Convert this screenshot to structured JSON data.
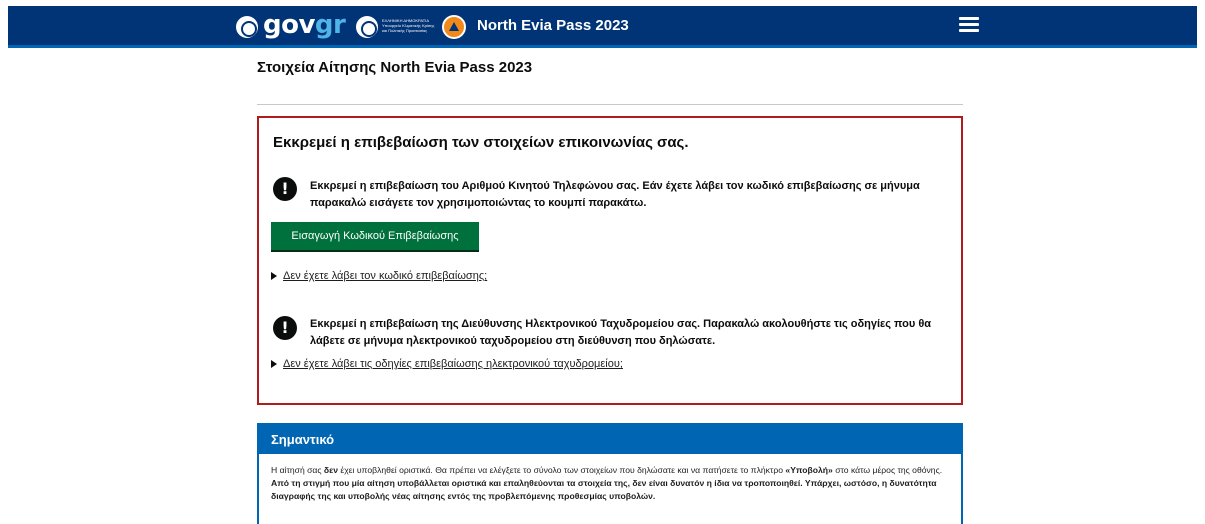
{
  "header": {
    "logo_gov": "gov",
    "logo_gr": "gr",
    "ministry_text": "ΕΛΛΗΝΙΚΗ ΔΗΜΟΚΡΑΤΙΑ Υπουργείο Κλιματικής Κρίσης και Πολιτικής Προστασίας",
    "app_title": "North Evia Pass 2023"
  },
  "page": {
    "title": "Στοιχεία Αίτησης North Evia Pass 2023"
  },
  "alert": {
    "heading": "Εκκρεμεί η επιβεβαίωση των στοιχείων επικοινωνίας σας.",
    "phone_text": "Εκκρεμεί η επιβεβαίωση του Αριθμού Κινητού Τηλεφώνου σας. Εάν έχετε λάβει τον κωδικό επιβεβαίωσης σε μήνυμα παρακαλώ εισάγετε τον χρησιμοποιώντας το κουμπί παρακάτω.",
    "verify_button": "Εισαγωγή Κωδικού Επιβεβαίωσης",
    "no_code_link": "Δεν έχετε λάβει τον κωδικό επιβεβαίωσης;",
    "email_text": "Εκκρεμεί η επιβεβαίωση της Διεύθυνσης Ηλεκτρονικού Ταχυδρομείου σας. Παρακαλώ ακολουθήστε τις οδηγίες που θα λάβετε σε μήνυμα ηλεκτρονικού ταχυδρομείου στη διεύθυνση που δηλώσατε.",
    "no_email_link": "Δεν έχετε λάβει τις οδηγίες επιβεβαίωσης ηλεκτρονικού ταχυδρομείου;",
    "icon_glyph": "!"
  },
  "important": {
    "heading": "Σημαντικό",
    "t1": "Η αίτησή σας ",
    "t2": "δεν",
    "t3": " έχει υποβληθεί οριστικά. Θα πρέπει να ελέγξετε το σύνολο των στοιχείων που δηλώσατε και να πατήσετε το πλήκτρο ",
    "t4": "«Υποβολή»",
    "t5": " στο κάτω μέρος της οθόνης. ",
    "t6": "Από τη στιγμή που μία αίτηση υποβάλλεται οριστικά και επαληθεύονται τα στοιχεία της, δεν είναι δυνατόν η ίδια να τροποποιηθεί. Υπάρχει, ωστόσο, η δυνατότητα διαγραφής της και υποβολής νέας αίτησης εντός της προβλεπόμενης προθεσμίας υποβολών."
  },
  "colors": {
    "header_bg": "#003476",
    "alert_border": "#b01c1c",
    "button_green": "#00703c",
    "info_blue": "#0065b3"
  }
}
